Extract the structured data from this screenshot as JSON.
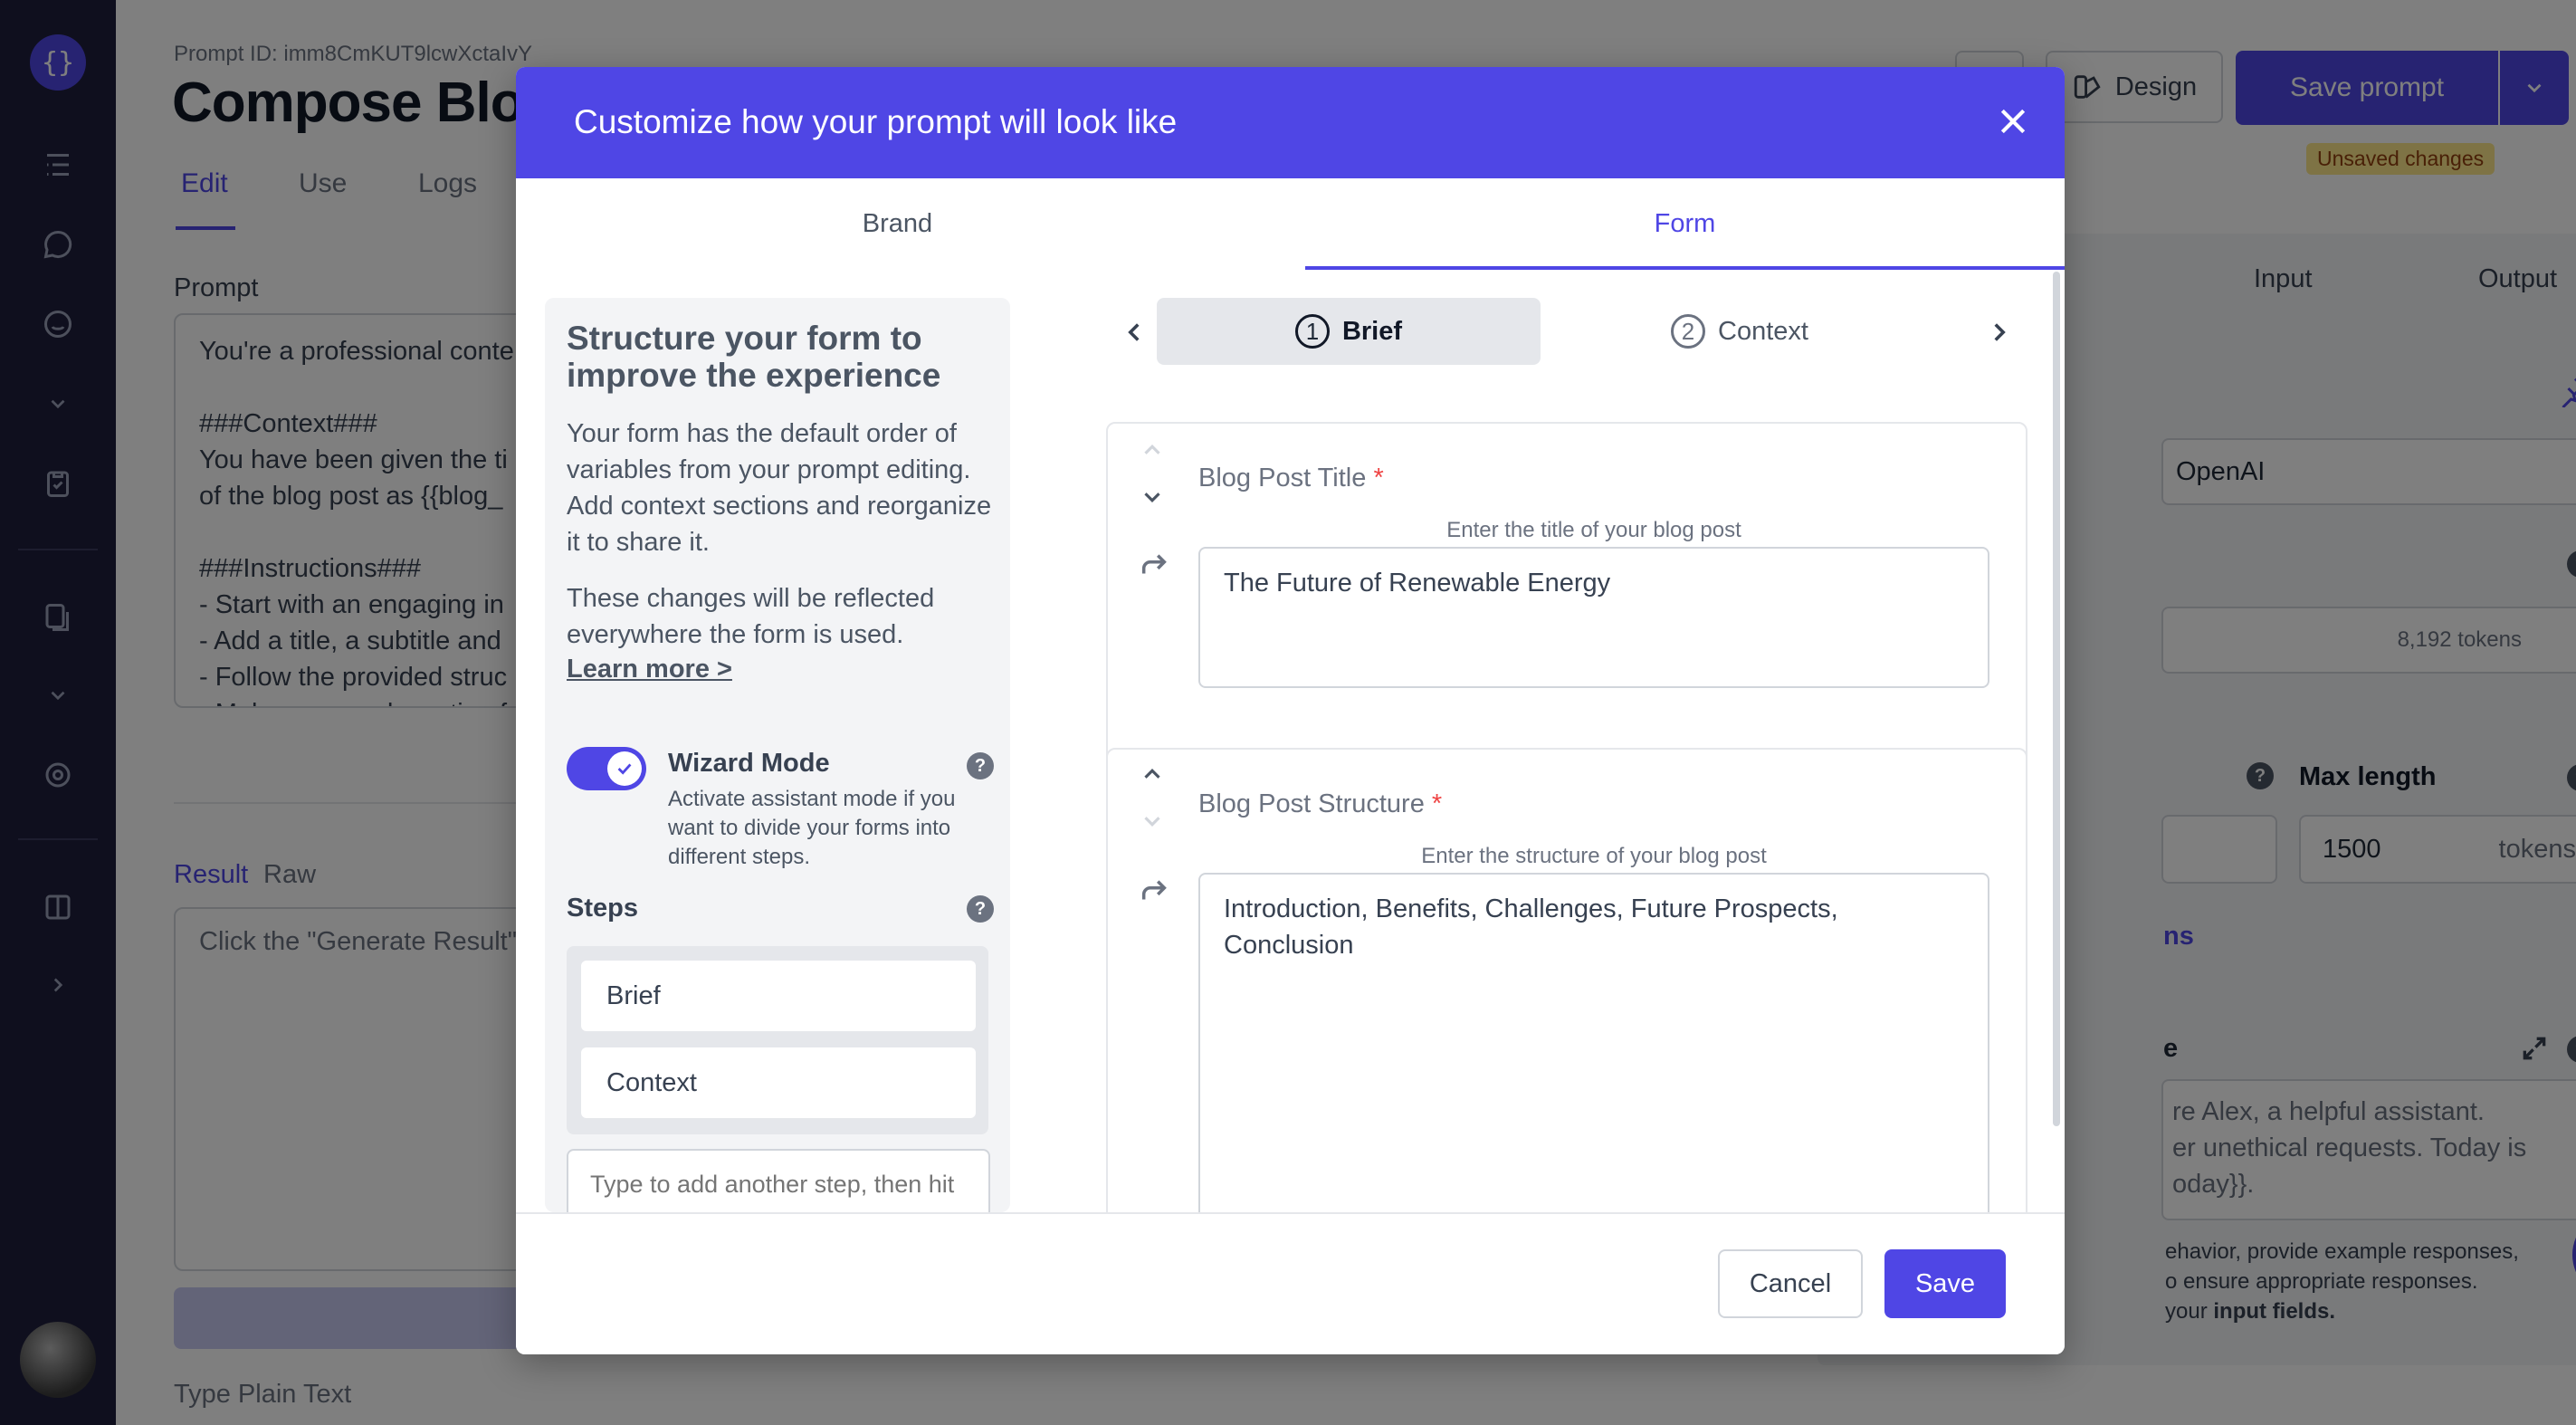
{
  "app": {
    "logo_glyph": "{}",
    "avatar": "avatar"
  },
  "page": {
    "prompt_id": "Prompt ID: imm8CmKUT9lcwXctaIvY",
    "title": "Compose Blog",
    "tabs": [
      "Edit",
      "Use",
      "Logs"
    ],
    "prompt_label": "Prompt",
    "prompt_lines": [
      "You're a professional conte",
      "",
      "###Context###",
      "You have been given the ti",
      "of the blog post as {{blog_",
      "",
      "###Instructions###",
      "- Start with an engaging in",
      "- Add a title, a subtitle and",
      "- Follow the provided struc",
      "- Make sure each section fo"
    ],
    "result_tab": "Result",
    "raw_tab": "Raw",
    "result_placeholder": "Click the \"Generate Result\"",
    "type_plain_text": "Type Plain Text",
    "design_button": "Design",
    "save_prompt_button": "Save prompt",
    "unsaved_badge": "Unsaved changes",
    "right_tabs": [
      "Input",
      "Output"
    ],
    "provider_value": "OpenAI",
    "context_tokens": "8,192 tokens",
    "max_length_label": "Max length",
    "max_length_value": "1500",
    "max_length_unit": "tokens",
    "more_options_fragment": "ns",
    "system_fragment": "e",
    "system_text": [
      "re Alex, a helpful assistant.",
      "er unethical requests. Today is",
      "oday}}."
    ],
    "help_text": [
      "ehavior, provide example responses,",
      "o ensure appropriate responses.",
      "your "
    ],
    "help_text_bold": "input fields."
  },
  "modal": {
    "title": "Customize how your prompt will look like",
    "tabs": {
      "brand": "Brand",
      "form": "Form",
      "active": "Form"
    },
    "left": {
      "heading": "Structure your form to improve the experience",
      "para1": "Your form has the default order of variables from your prompt editing. Add context sections and reorganize it to share it.",
      "para2": "These changes will be reflected everywhere the form is used.",
      "learn_more": "Learn more >",
      "wizard_label": "Wizard Mode",
      "wizard_enabled": true,
      "wizard_desc": "Activate assistant mode if you want to divide your forms into different steps.",
      "steps_label": "Steps",
      "steps": [
        "Brief",
        "Context"
      ],
      "add_step_placeholder": "Type to add another step, then hit"
    },
    "stepper": {
      "steps": [
        {
          "num": "1",
          "label": "Brief"
        },
        {
          "num": "2",
          "label": "Context"
        }
      ],
      "active": 0
    },
    "fields": [
      {
        "label": "Blog Post Title",
        "required": "*",
        "description": "Enter the title of your blog post",
        "value": "The Future of Renewable Energy"
      },
      {
        "label": "Blog Post Structure",
        "required": "*",
        "description": "Enter the structure of your blog post",
        "value": "Introduction, Benefits, Challenges, Future Prospects, Conclusion"
      }
    ],
    "cancel_button": "Cancel",
    "save_button": "Save"
  },
  "colors": {
    "primary": "#4f46e5",
    "sidebar": "#1e1e3c",
    "required": "#ef4444",
    "unsaved_bg": "#fde68a"
  }
}
